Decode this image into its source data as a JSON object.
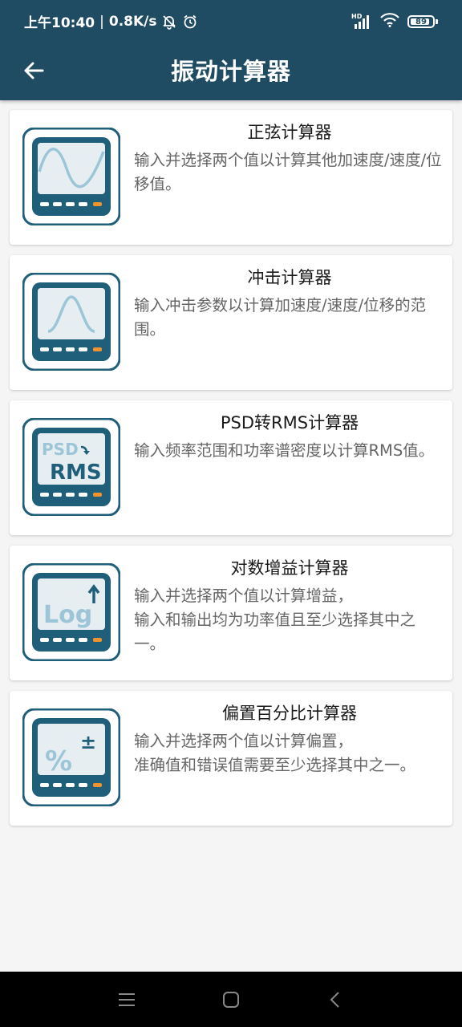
{
  "status_bar": {
    "time": "上午10:40",
    "speed": "0.8K/s",
    "battery": "89",
    "battery_level": 0.89,
    "hd_label": "HD"
  },
  "toolbar": {
    "title": "振动计算器",
    "back_icon": "arrow-left-icon"
  },
  "cards": [
    {
      "title": "正弦计算器",
      "desc": "输入并选择两个值以计算其他加速度/速度/位移值。",
      "icon": "sine-wave-icon"
    },
    {
      "title": "冲击计算器",
      "desc": "输入冲击参数以计算加速度/速度/位移的范围。",
      "icon": "shock-pulse-icon"
    },
    {
      "title": "PSD转RMS计算器",
      "desc": "输入频率范围和功率谱密度以计算RMS值。",
      "icon": "psd-rms-icon",
      "icon_text_top": "PSD",
      "icon_text_bottom": "RMS"
    },
    {
      "title": "对数增益计算器",
      "desc": "输入并选择两个值以计算增益，\n输入和输出均为功率值且至少选择其中之一。",
      "icon": "log-gain-icon",
      "icon_text": "Log"
    },
    {
      "title": "偏置百分比计算器",
      "desc": "输入并选择两个值以计算偏置，\n准确值和错误值需要至少选择其中之一。",
      "icon": "percent-bias-icon",
      "icon_text": "%",
      "icon_sup": "±"
    }
  ],
  "colors": {
    "header": "#1f4b63",
    "icon_dark": "#1f5f7a",
    "icon_screen": "#e6eef2",
    "icon_art": "#9cc5d8",
    "accent_orange": "#f0922e"
  },
  "navbar": {
    "menu_icon": "menu-icon",
    "home_icon": "home-icon",
    "back_icon": "back-chevron-icon"
  }
}
